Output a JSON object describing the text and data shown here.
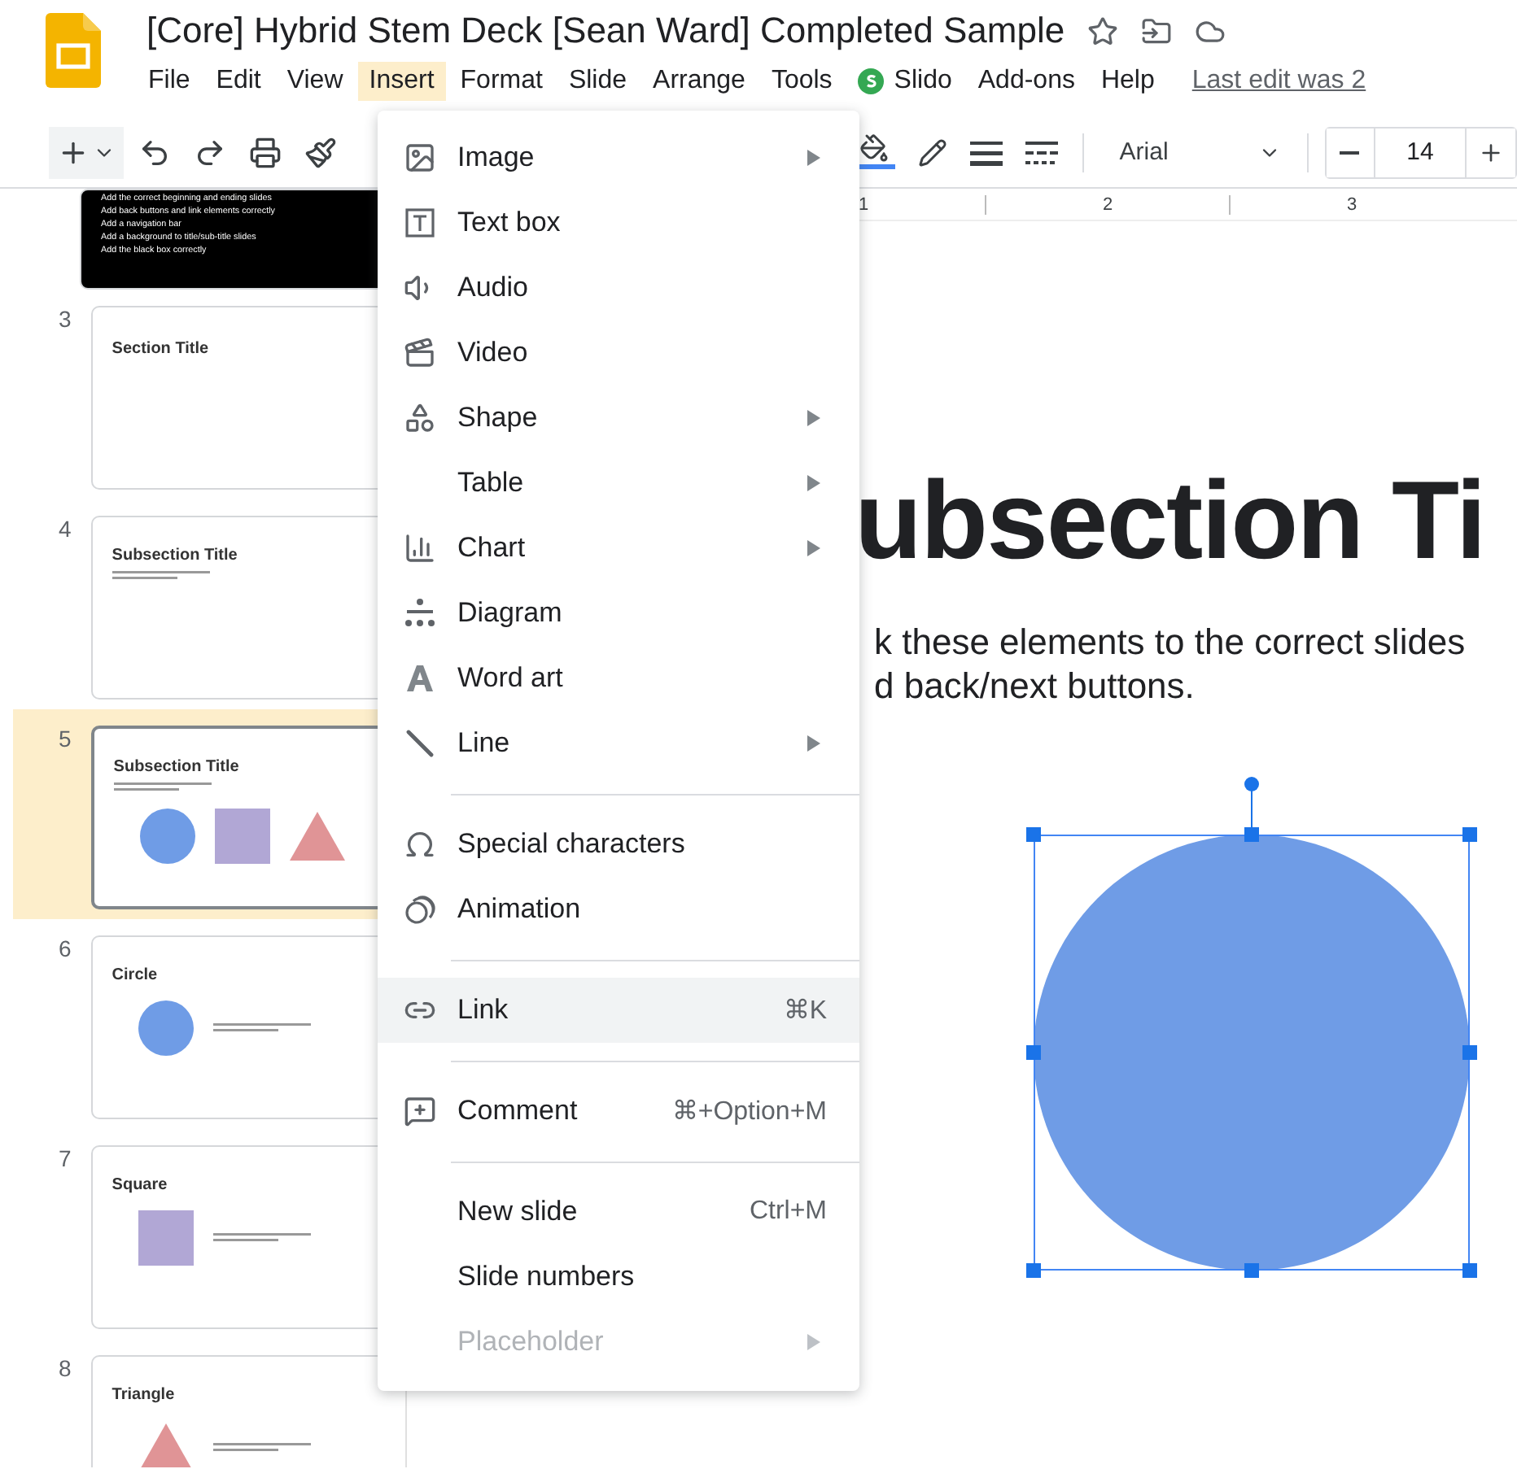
{
  "document": {
    "title": "[Core] Hybrid Stem Deck [Sean Ward] Completed Sample",
    "last_edit": "Last edit was 2"
  },
  "menu_bar": [
    {
      "label": "File",
      "selected": false,
      "kind": "menu"
    },
    {
      "label": "Edit",
      "selected": false,
      "kind": "menu"
    },
    {
      "label": "View",
      "selected": false,
      "kind": "menu"
    },
    {
      "label": "Insert",
      "selected": true,
      "kind": "menu"
    },
    {
      "label": "Format",
      "selected": false,
      "kind": "menu"
    },
    {
      "label": "Slide",
      "selected": false,
      "kind": "menu"
    },
    {
      "label": "Arrange",
      "selected": false,
      "kind": "menu"
    },
    {
      "label": "Tools",
      "selected": false,
      "kind": "menu"
    },
    {
      "label": "Slido",
      "selected": false,
      "kind": "addon"
    },
    {
      "label": "Add-ons",
      "selected": false,
      "kind": "menu"
    },
    {
      "label": "Help",
      "selected": false,
      "kind": "menu"
    }
  ],
  "toolbar": {
    "font": "Arial",
    "font_size": "14"
  },
  "ruler": [
    "1",
    "2",
    "3"
  ],
  "slides": [
    {
      "kind": "list",
      "lines": [
        "Add the correct beginning and ending slides",
        "Add back buttons and link elements correctly",
        "Add a navigation bar",
        "Add a background to title/sub-title slides",
        "Add the black box correctly"
      ],
      "selected": false
    },
    {
      "kind": "title",
      "number": "3",
      "title": "Section Title",
      "selected": false
    },
    {
      "kind": "content",
      "number": "4",
      "title": "Subsection Title",
      "selected": false
    },
    {
      "kind": "content",
      "number": "5",
      "title": "Subsection Title",
      "selected": true,
      "shapes": [
        {
          "kind": "circle",
          "color": "#6f9ce6"
        },
        {
          "kind": "square",
          "color": "#b1a7d5"
        },
        {
          "kind": "triangle",
          "color": "#e09496"
        }
      ]
    },
    {
      "kind": "content",
      "number": "6",
      "title": "Circle",
      "selected": false,
      "shapes": [
        {
          "kind": "circle",
          "color": "#6f9ce6"
        }
      ]
    },
    {
      "kind": "content",
      "number": "7",
      "title": "Square",
      "selected": false,
      "shapes": [
        {
          "kind": "square",
          "color": "#b1a7d5"
        }
      ]
    },
    {
      "kind": "content",
      "number": "8",
      "title": "Triangle",
      "selected": false,
      "shapes": [
        {
          "kind": "triangle",
          "color": "#e09496"
        }
      ]
    }
  ],
  "canvas": {
    "title": "ubsection Ti",
    "body": [
      "k these elements to the correct slides",
      "d back/next buttons."
    ],
    "shape": {
      "kind": "circle",
      "selected": true
    }
  },
  "insert_menu": [
    {
      "kind": "item",
      "label": "Image",
      "submenu": true,
      "disabled": false,
      "highlighted": false
    },
    {
      "kind": "item",
      "label": "Text box",
      "submenu": false,
      "disabled": false,
      "highlighted": false
    },
    {
      "kind": "item",
      "label": "Audio",
      "submenu": false,
      "disabled": false,
      "highlighted": false
    },
    {
      "kind": "item",
      "label": "Video",
      "submenu": false,
      "disabled": false,
      "highlighted": false
    },
    {
      "kind": "item",
      "label": "Shape",
      "submenu": true,
      "disabled": false,
      "highlighted": false
    },
    {
      "kind": "item",
      "label": "Table",
      "submenu": true,
      "disabled": false,
      "highlighted": false
    },
    {
      "kind": "item",
      "label": "Chart",
      "submenu": true,
      "disabled": false,
      "highlighted": false
    },
    {
      "kind": "item",
      "label": "Diagram",
      "submenu": false,
      "disabled": false,
      "highlighted": false
    },
    {
      "kind": "item",
      "label": "Word art",
      "submenu": false,
      "disabled": false,
      "highlighted": false
    },
    {
      "kind": "item",
      "label": "Line",
      "submenu": true,
      "disabled": false,
      "highlighted": false
    },
    {
      "kind": "divider"
    },
    {
      "kind": "item",
      "label": "Special characters",
      "submenu": false,
      "disabled": false,
      "highlighted": false
    },
    {
      "kind": "item",
      "label": "Animation",
      "submenu": false,
      "disabled": false,
      "highlighted": false
    },
    {
      "kind": "divider"
    },
    {
      "kind": "item",
      "label": "Link",
      "shortcut": "⌘K",
      "submenu": false,
      "disabled": false,
      "highlighted": true
    },
    {
      "kind": "divider"
    },
    {
      "kind": "item",
      "label": "Comment",
      "shortcut": "⌘+Option+M",
      "submenu": false,
      "disabled": false,
      "highlighted": false
    },
    {
      "kind": "divider"
    },
    {
      "kind": "item",
      "label": "New slide",
      "shortcut": "Ctrl+M",
      "submenu": false,
      "disabled": false,
      "highlighted": false
    },
    {
      "kind": "item",
      "label": "Slide numbers",
      "submenu": false,
      "disabled": false,
      "highlighted": false
    },
    {
      "kind": "item",
      "label": "Placeholder",
      "submenu": true,
      "disabled": true,
      "highlighted": false
    }
  ]
}
